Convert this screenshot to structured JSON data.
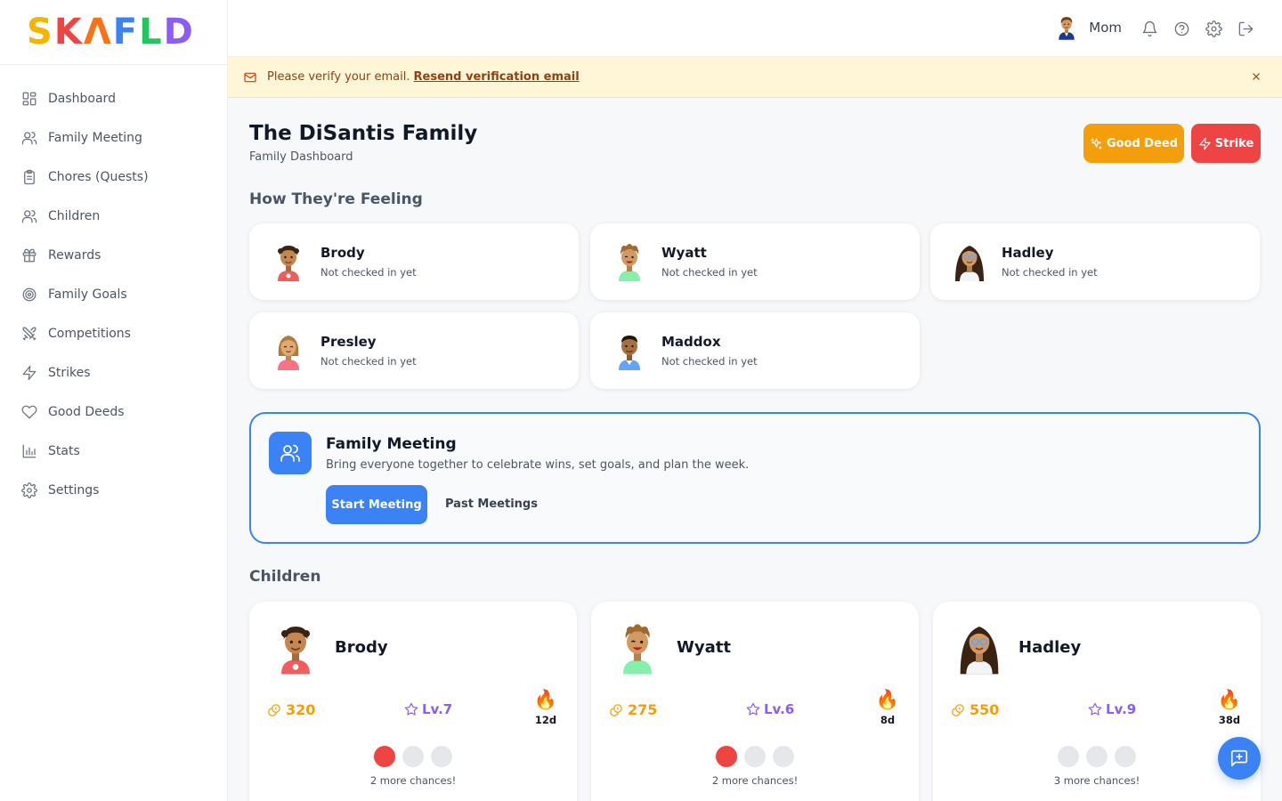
{
  "app": {
    "logo_letters": [
      {
        "char": "S",
        "color": "#f5b400"
      },
      {
        "char": "K",
        "color": "#ef4444"
      },
      {
        "char": "Λ",
        "color": "#f97316"
      },
      {
        "char": "F",
        "color": "#3b82f6"
      },
      {
        "char": "L",
        "color": "#22c55e"
      },
      {
        "char": "D",
        "color": "#8b5cf6"
      }
    ]
  },
  "sidebar": {
    "items": [
      {
        "label": "Dashboard",
        "icon": "dashboard-icon"
      },
      {
        "label": "Family Meeting",
        "icon": "users-icon"
      },
      {
        "label": "Chores (Quests)",
        "icon": "clipboard-icon"
      },
      {
        "label": "Children",
        "icon": "children-icon"
      },
      {
        "label": "Rewards",
        "icon": "gift-icon"
      },
      {
        "label": "Family Goals",
        "icon": "target-icon"
      },
      {
        "label": "Competitions",
        "icon": "swords-icon"
      },
      {
        "label": "Strikes",
        "icon": "lightning-icon"
      },
      {
        "label": "Good Deeds",
        "icon": "heart-icon"
      },
      {
        "label": "Stats",
        "icon": "bar-chart-icon"
      },
      {
        "label": "Settings",
        "icon": "gear-icon"
      }
    ]
  },
  "header": {
    "user_name": "Mom",
    "icons": [
      "bell-icon",
      "help-icon",
      "gear-icon",
      "logout-icon"
    ]
  },
  "banner": {
    "text": "Please verify your email.",
    "link": "Resend verification email"
  },
  "page": {
    "title": "The DiSantis Family",
    "subtitle": "Family Dashboard",
    "good_deed_button": "Good Deed",
    "strike_button": "Strike"
  },
  "feelings": {
    "title": "How They're Feeling",
    "cards": [
      {
        "name": "Brody",
        "status": "Not checked in yet"
      },
      {
        "name": "Wyatt",
        "status": "Not checked in yet"
      },
      {
        "name": "Hadley",
        "status": "Not checked in yet"
      },
      {
        "name": "Presley",
        "status": "Not checked in yet"
      },
      {
        "name": "Maddox",
        "status": "Not checked in yet"
      }
    ]
  },
  "meeting": {
    "title": "Family Meeting",
    "description": "Bring everyone together to celebrate wins, set goals, and plan the week.",
    "start_button": "Start Meeting",
    "past_button": "Past Meetings"
  },
  "children": {
    "title": "Children",
    "cards": [
      {
        "name": "Brody",
        "coins": "320",
        "level": "Lv.7",
        "streak": "12d",
        "strikes_used": 1,
        "strikes_total": 3,
        "chances_text": "2 more chances!"
      },
      {
        "name": "Wyatt",
        "coins": "275",
        "level": "Lv.6",
        "streak": "8d",
        "strikes_used": 1,
        "strikes_total": 3,
        "chances_text": "2 more chances!"
      },
      {
        "name": "Hadley",
        "coins": "550",
        "level": "Lv.9",
        "streak": "38d",
        "strikes_used": 0,
        "strikes_total": 3,
        "chances_text": "3 more chances!"
      }
    ]
  },
  "colors": {
    "primary": "#3b82f6",
    "good_deed": "#f59e0b",
    "strike": "#ef4444",
    "level": "#8b5cf6",
    "banner_bg": "#fef6d7"
  }
}
